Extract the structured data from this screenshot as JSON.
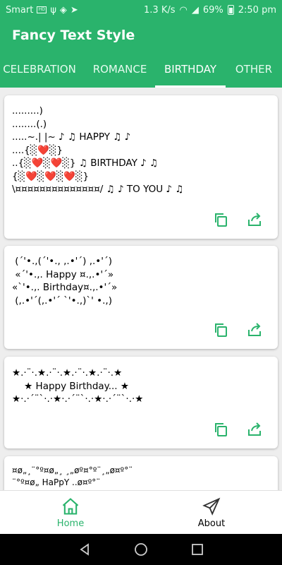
{
  "status_bar": {
    "carrier": "Smart",
    "speed": "1.3 K/s",
    "battery": "69%",
    "time": "2:50 pm"
  },
  "app": {
    "title": "Fancy Text Style"
  },
  "tabs": [
    {
      "label": "CELEBRATION"
    },
    {
      "label": "ROMANCE"
    },
    {
      "label": "BIRTHDAY"
    },
    {
      "label": "OTHER"
    }
  ],
  "active_tab": "BIRTHDAY",
  "cards": [
    {
      "text": ".........)\n........(.)\n.....~.| |~ ♪ ♫ HAPPY ♫ ♪\n....{░❤️░}\n..{░❤️░❤️░} ♫ BIRTHDAY ♪ ♫\n{░❤️░❤️░❤️░}\n\\¤¤¤¤¤¤¤¤¤¤¤¤¤¤/ ♫ ♪ TO YOU ♪ ♫"
    },
    {
      "text": " (´'•.,(´'•., ,.•'´) ,.•'´)\n «´'•.,. Happy ¤.,.•'´»\n«`'•.,. Birthday¤.,.•'´»\n (,.•'´(,.•'´ `'•.,)`' •.,)"
    },
    {
      "text": "★.·¨·.★.·¨·.★.·¨·.★.·¨·.★\n    ★ Happy Birthday... ★\n★·.·´¨`·.·★·.·´¨`·.·★·.·´¨`·.·★"
    },
    {
      "text": "¤ø„¸¨°º¤ø„¸ ¸„øº¤°º¨¸„ø¤º°¨\n¨°º¤ø„ HaPpY ..ø¤º°¨"
    }
  ],
  "bottom_nav": [
    {
      "label": "Home",
      "icon": "home-icon"
    },
    {
      "label": "About",
      "icon": "send-icon"
    }
  ],
  "colors": {
    "primary": "#2ab36c",
    "card_bg": "#ffffff",
    "background": "#eeeeee"
  }
}
